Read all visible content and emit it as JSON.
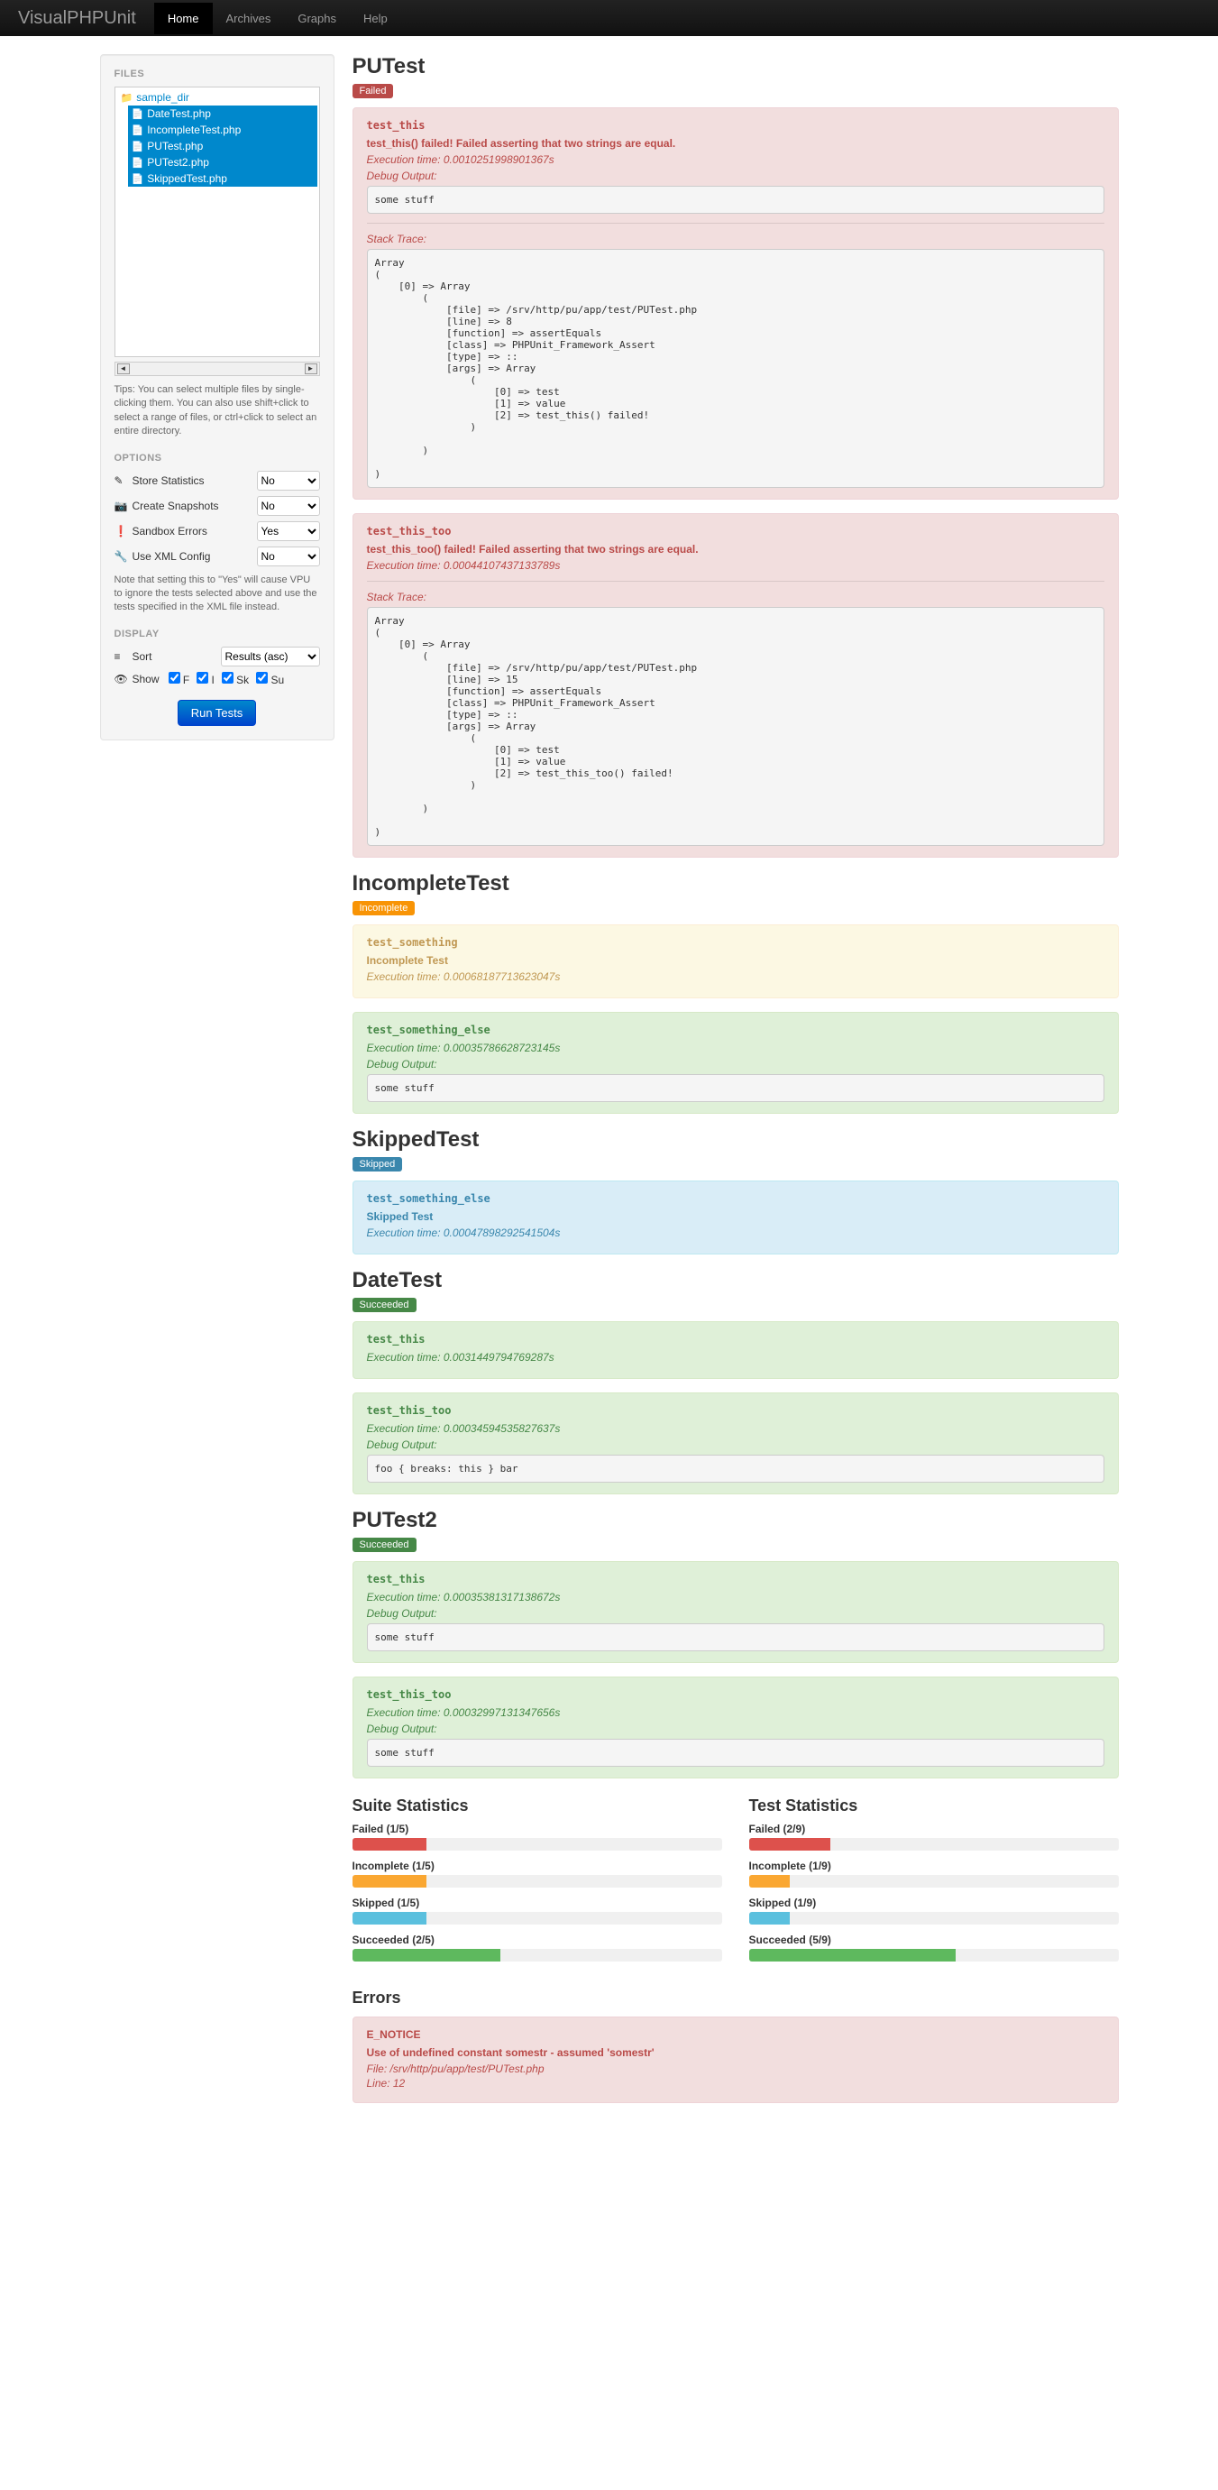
{
  "nav": {
    "brand": "VisualPHPUnit",
    "items": [
      "Home",
      "Archives",
      "Graphs",
      "Help"
    ],
    "active": 0
  },
  "sidebar": {
    "files_label": "FILES",
    "folder": "sample_dir",
    "files": [
      "DateTest.php",
      "IncompleteTest.php",
      "PUTest.php",
      "PUTest2.php",
      "SkippedTest.php"
    ],
    "tips": "Tips: You can select multiple files by single-clicking them. You can also use shift+click to select a range of files, or ctrl+click to select an entire directory.",
    "options_label": "OPTIONS",
    "options": [
      {
        "icon": "✎",
        "label": "Store Statistics",
        "value": "No"
      },
      {
        "icon": "📷",
        "label": "Create Snapshots",
        "value": "No"
      },
      {
        "icon": "❗",
        "label": "Sandbox Errors",
        "value": "Yes"
      },
      {
        "icon": "🔧",
        "label": "Use XML Config",
        "value": "No"
      }
    ],
    "note": "Note that setting this to \"Yes\" will cause VPU to ignore the tests selected above and use the tests specified in the XML file instead.",
    "display_label": "DISPLAY",
    "sort": {
      "icon": "≡",
      "label": "Sort",
      "value": "Results (asc)"
    },
    "show": {
      "icon": "👁",
      "label": "Show",
      "checks": [
        "F",
        "I",
        "Sk",
        "Su"
      ]
    },
    "run_button": "Run Tests"
  },
  "suites": [
    {
      "name": "PUTest",
      "status": "Failed",
      "badge": "badge-failed",
      "tests": [
        {
          "status": "failed",
          "name": "test_this",
          "message": "test_this() failed! Failed asserting that two strings are equal.",
          "time": "Execution time: 0.0010251998901367s",
          "debug_label": "Debug Output:",
          "debug": "some stuff",
          "trace_label": "Stack Trace:",
          "trace": "Array\n(\n    [0] => Array\n        (\n            [file] => /srv/http/pu/app/test/PUTest.php\n            [line] => 8\n            [function] => assertEquals\n            [class] => PHPUnit_Framework_Assert\n            [type] => ::\n            [args] => Array\n                (\n                    [0] => test\n                    [1] => value\n                    [2] => test_this() failed!\n                )\n\n        )\n\n)"
        },
        {
          "status": "failed",
          "name": "test_this_too",
          "message": "test_this_too() failed! Failed asserting that two strings are equal.",
          "time": "Execution time: 0.00044107437133789s",
          "trace_label": "Stack Trace:",
          "trace": "Array\n(\n    [0] => Array\n        (\n            [file] => /srv/http/pu/app/test/PUTest.php\n            [line] => 15\n            [function] => assertEquals\n            [class] => PHPUnit_Framework_Assert\n            [type] => ::\n            [args] => Array\n                (\n                    [0] => test\n                    [1] => value\n                    [2] => test_this_too() failed!\n                )\n\n        )\n\n)"
        }
      ]
    },
    {
      "name": "IncompleteTest",
      "status": "Incomplete",
      "badge": "badge-incomplete",
      "tests": [
        {
          "status": "incomplete",
          "name": "test_something",
          "message": "Incomplete Test",
          "time": "Execution time: 0.00068187713623047s"
        },
        {
          "status": "succeeded",
          "name": "test_something_else",
          "time": "Execution time: 0.00035786628723145s",
          "debug_label": "Debug Output:",
          "debug": "some stuff"
        }
      ]
    },
    {
      "name": "SkippedTest",
      "status": "Skipped",
      "badge": "badge-skipped",
      "tests": [
        {
          "status": "skipped",
          "name": "test_something_else",
          "message": "Skipped Test",
          "time": "Execution time: 0.00047898292541504s"
        }
      ]
    },
    {
      "name": "DateTest",
      "status": "Succeeded",
      "badge": "badge-succeeded",
      "tests": [
        {
          "status": "succeeded",
          "name": "test_this",
          "time": "Execution time: 0.0031449794769287s"
        },
        {
          "status": "succeeded",
          "name": "test_this_too",
          "time": "Execution time: 0.00034594535827637s",
          "debug_label": "Debug Output:",
          "debug": "foo { breaks: this } bar"
        }
      ]
    },
    {
      "name": "PUTest2",
      "status": "Succeeded",
      "badge": "badge-succeeded",
      "tests": [
        {
          "status": "succeeded",
          "name": "test_this",
          "time": "Execution time: 0.00035381317138672s",
          "debug_label": "Debug Output:",
          "debug": "some stuff"
        },
        {
          "status": "succeeded",
          "name": "test_this_too",
          "time": "Execution time: 0.00032997131347656s",
          "debug_label": "Debug Output:",
          "debug": "some stuff"
        }
      ]
    }
  ],
  "stats": {
    "suite": {
      "title": "Suite Statistics",
      "rows": [
        {
          "label": "Failed (1/5)",
          "cls": "bar-failed",
          "pct": 20
        },
        {
          "label": "Incomplete (1/5)",
          "cls": "bar-incomplete",
          "pct": 20
        },
        {
          "label": "Skipped (1/5)",
          "cls": "bar-skipped",
          "pct": 20
        },
        {
          "label": "Succeeded (2/5)",
          "cls": "bar-succeeded",
          "pct": 40
        }
      ]
    },
    "test": {
      "title": "Test Statistics",
      "rows": [
        {
          "label": "Failed (2/9)",
          "cls": "bar-failed",
          "pct": 22
        },
        {
          "label": "Incomplete (1/9)",
          "cls": "bar-incomplete",
          "pct": 11
        },
        {
          "label": "Skipped (1/9)",
          "cls": "bar-skipped",
          "pct": 11
        },
        {
          "label": "Succeeded (5/9)",
          "cls": "bar-succeeded",
          "pct": 56
        }
      ]
    }
  },
  "errors": {
    "title": "Errors",
    "type": "E_NOTICE",
    "message": "Use of undefined constant somestr - assumed 'somestr'",
    "file": "File: /srv/http/pu/app/test/PUTest.php",
    "line": "Line: 12"
  }
}
